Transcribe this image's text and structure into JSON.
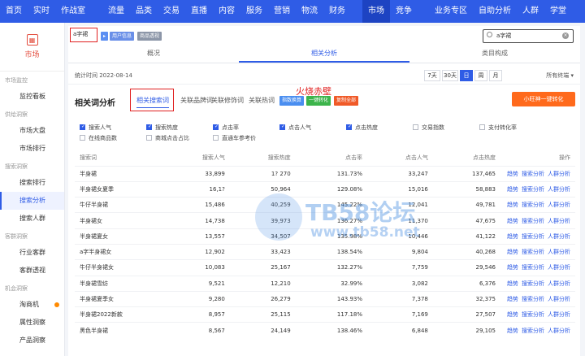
{
  "topnav": {
    "items": [
      {
        "label": "首页"
      },
      {
        "label": "实时"
      },
      {
        "label": "作战室"
      },
      {
        "label": "流量"
      },
      {
        "label": "品类"
      },
      {
        "label": "交易"
      },
      {
        "label": "直播"
      },
      {
        "label": "内容"
      },
      {
        "label": "服务"
      },
      {
        "label": "营销"
      },
      {
        "label": "物流"
      },
      {
        "label": "财务"
      },
      {
        "label": "市场"
      },
      {
        "label": "竞争"
      },
      {
        "label": "业务专区"
      },
      {
        "label": "自助分析"
      },
      {
        "label": "人群"
      },
      {
        "label": "学堂"
      }
    ],
    "active": "市场"
  },
  "sidebar": {
    "logo_label": "市场",
    "groups": [
      {
        "title": "市场监控",
        "items": [
          {
            "label": "监控看板"
          }
        ]
      },
      {
        "title": "供给洞察",
        "items": [
          {
            "label": "市场大盘"
          },
          {
            "label": "市场排行"
          }
        ]
      },
      {
        "title": "搜索洞察",
        "items": [
          {
            "label": "搜索排行"
          },
          {
            "label": "搜索分析"
          },
          {
            "label": "搜索人群"
          }
        ]
      },
      {
        "title": "客群洞察",
        "items": [
          {
            "label": "行业客群"
          },
          {
            "label": "客群透视"
          }
        ]
      },
      {
        "title": "机会洞察",
        "items": [
          {
            "label": "淘商机"
          },
          {
            "label": "属性洞察"
          },
          {
            "label": "产品洞察"
          }
        ]
      }
    ],
    "active": "搜索分析"
  },
  "search": {
    "keyword_chip": "a字裙",
    "tag_user_info": "用户信息",
    "tag_product": "商品透视",
    "value": "a字裙"
  },
  "tabs": [
    "概况",
    "相关分析",
    "类目构成"
  ],
  "active_tab": "相关分析",
  "stats": {
    "time_label": "统计时间 2022-08-14",
    "periods": [
      "7天",
      "30天",
      "日",
      "周",
      "月"
    ],
    "active_period": "日",
    "terminal": "所有终端"
  },
  "section": {
    "title": "相关词分析",
    "subtabs": [
      "相关搜索词",
      "关联品牌词",
      "关联修饰词",
      "关联热词"
    ],
    "active_subtab": "相关搜索词",
    "annotation": "火烧赤壁",
    "btn_index": "指数换算",
    "btn_convert": "一键转化",
    "btn_copy": "复制全部",
    "btn_plugin": "小旺神一键转化"
  },
  "checks": [
    {
      "label": "搜索人气",
      "on": true
    },
    {
      "label": "搜索热度",
      "on": true
    },
    {
      "label": "点击率",
      "on": true
    },
    {
      "label": "点击人气",
      "on": true
    },
    {
      "label": "点击热度",
      "on": true
    },
    {
      "label": "交易指数",
      "on": false
    },
    {
      "label": "支付转化率",
      "on": false
    },
    {
      "label": "在线商品数",
      "on": false
    },
    {
      "label": "商城点击占比",
      "on": false
    },
    {
      "label": "直通车参考价",
      "on": false
    }
  ],
  "table": {
    "headers": [
      "搜索词",
      "搜索人气",
      "搜索热度",
      "点击率",
      "点击人气",
      "点击热度",
      "操作"
    ],
    "ops": [
      "趋势",
      "搜索分析",
      "人群分析"
    ],
    "rows": [
      [
        "半身裙",
        "33,899",
        "1? 270",
        "131.73%",
        "33,247",
        "137,465"
      ],
      [
        "半身裙女夏季",
        "16,1?",
        "50,964",
        "129.08%",
        "15,016",
        "58,883"
      ],
      [
        "牛仔半身裙",
        "15,486",
        "40,259",
        "145.22%",
        "12,041",
        "49,781"
      ],
      [
        "半身裙女",
        "14,738",
        "39,973",
        "136.27%",
        "11,370",
        "47,675"
      ],
      [
        "半身裙夏女",
        "13,557",
        "34,507",
        "135.98%",
        "10,446",
        "41,122"
      ],
      [
        "a字半身裙女",
        "12,902",
        "33,423",
        "138.54%",
        "9,804",
        "40,268"
      ],
      [
        "牛仔半身裙女",
        "10,083",
        "25,167",
        "132.27%",
        "7,759",
        "29,546"
      ],
      [
        "半身裙雪纺",
        "9,521",
        "12,210",
        "32.99%",
        "3,082",
        "6,376"
      ],
      [
        "半身裙夏季女",
        "9,280",
        "26,279",
        "143.93%",
        "7,378",
        "32,375"
      ],
      [
        "半身裙2022新款",
        "8,957",
        "25,115",
        "117.18%",
        "7,169",
        "27,507"
      ],
      [
        "黑色半身裙",
        "8,567",
        "24,149",
        "138.46%",
        "6,848",
        "29,105"
      ]
    ]
  },
  "watermark": {
    "title": "TB58论坛",
    "url": "www.tb58.net"
  }
}
